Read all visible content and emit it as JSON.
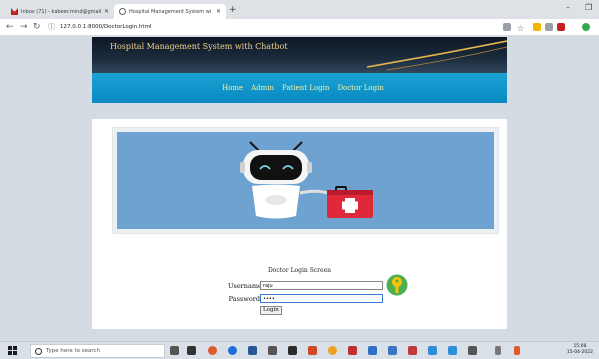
{
  "browser": {
    "tabs": [
      {
        "label": "Inbox (71) - kabeer.mind@gmail.c",
        "active": false
      },
      {
        "label": "Hospital Management System wi",
        "active": true
      }
    ],
    "url": "127.0.0.1:8000/DoctorLogin.html"
  },
  "site": {
    "title": "Hospital Management System with Chatbot",
    "nav": [
      "Home",
      "Admin",
      "Patient Login",
      "Doctor Login"
    ]
  },
  "form": {
    "title": "Doctor Login Screen",
    "username_label": "Username",
    "username_value": "raju",
    "password_label": "Password",
    "password_value": "••••",
    "submit_label": "Login"
  },
  "taskbar": {
    "search_placeholder": "Type here to search",
    "time": "15:08",
    "date": "15-04-2022"
  },
  "colors": {
    "banner": "#0d1624",
    "navbar": "#1aa2d4",
    "nav_text": "#f7f2a6",
    "hero_bg": "#6ea2d0",
    "kit_red": "#e0283a"
  }
}
